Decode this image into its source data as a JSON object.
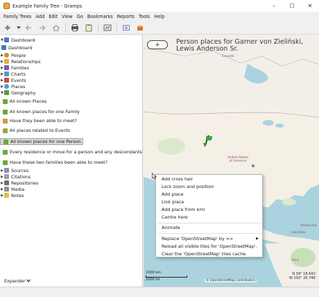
{
  "window": {
    "title": "Example Family Tree - Gramps",
    "minimize": "–",
    "maximize": "☐",
    "close": "✕"
  },
  "menu": [
    "Family Trees",
    "Add",
    "Edit",
    "View",
    "Go",
    "Bookmarks",
    "Reports",
    "Tools",
    "Help"
  ],
  "sidebar": {
    "dashboard_category": "Dashboard",
    "dashboard_view": "Dashboard",
    "categories_top": [
      "People",
      "Relationships",
      "Families",
      "Charts",
      "Events",
      "Places",
      "Geography"
    ],
    "geography_views": [
      "All known Places",
      "All known places for one Family",
      "Have they been able to meet?",
      "All places related to Events",
      "All known places for one Person",
      "Every residence or move for a person and any descendants",
      "Have these two families been able to meet?"
    ],
    "selected_view": "All known places for one Person",
    "categories_bottom": [
      "Sources",
      "Citations",
      "Repositories",
      "Media",
      "Notes"
    ],
    "expander": "Expander"
  },
  "map": {
    "title": "Person places for Garner von Zieliński, Lewis Anderson Sr.",
    "crosshair_symbol": "+",
    "labels": {
      "canada": "Canada",
      "usa": "United States of America",
      "venezuela": "Venezuela",
      "colombia": "Colombia",
      "peru": "Perú"
    },
    "scale_km": "1000 km",
    "scale_mi": "1000 mi",
    "attribution": "© OpenStreetMap contributors",
    "coord_lat": "N 39° 18.641'",
    "coord_lon": "W 102° 26.746'"
  },
  "context_menu": {
    "items": [
      "Add cross hair",
      "Lock zoom and position",
      "Add place",
      "Link place",
      "Add place from kml",
      "Centre here",
      "Animate",
      "Replace 'OpenStreetMap' by =>",
      "Reload all visible tiles for 'OpenStreetMap'.",
      "Clear the 'OpenStreetMap' tiles cache."
    ],
    "submenu_arrow": "▶"
  }
}
